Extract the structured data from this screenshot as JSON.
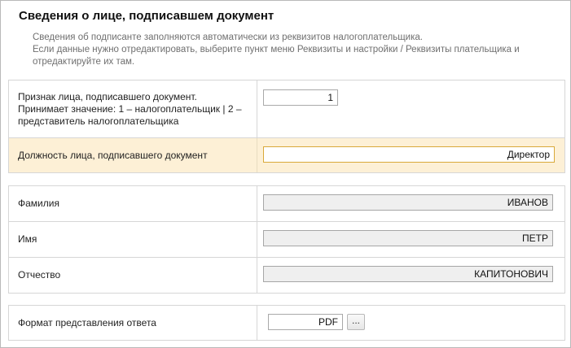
{
  "title": "Сведения о лице, подписавшем документ",
  "info": {
    "line1": "Сведения об подписанте заполняются автоматически из реквизитов налогоплательщика.",
    "line2": "Если данные нужно отредактировать, выберите пункт меню Реквизиты и настройки / Реквизиты плательщика и отредактируйте их там."
  },
  "signer": {
    "sign_label": "Признак лица, подписавшего документ. Принимает значение: 1 – налогоплательщик | 2 – представитель налогоплательщика",
    "sign_value": "1",
    "position_label": "Должность лица, подписавшего документ",
    "position_value": "Директор"
  },
  "person": {
    "surname_label": "Фамилия",
    "surname_value": "ИВАНОВ",
    "name_label": "Имя",
    "name_value": "ПЕТР",
    "patronymic_label": "Отчество",
    "patronymic_value": "КАПИТОНОВИЧ"
  },
  "response": {
    "format_label": "Формат представления ответа",
    "format_value": "PDF",
    "select_button": "..."
  }
}
